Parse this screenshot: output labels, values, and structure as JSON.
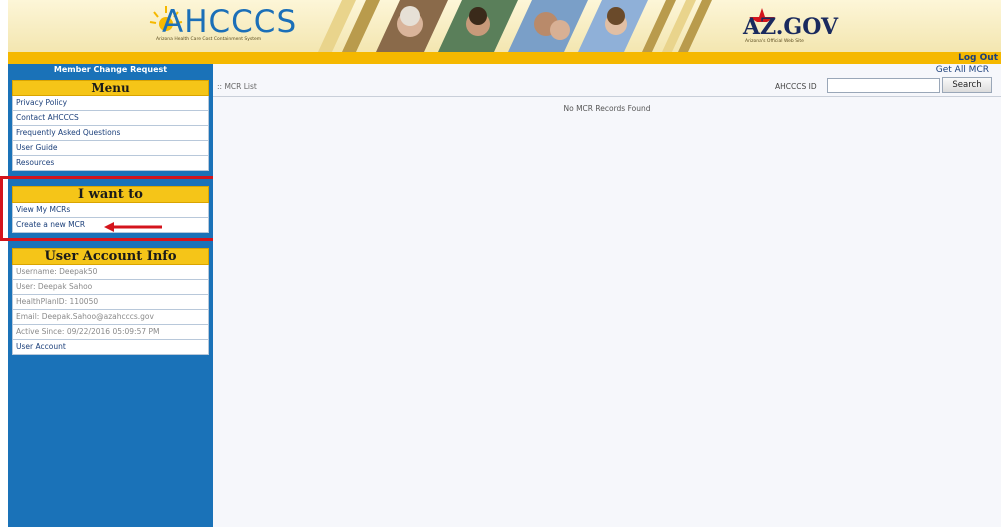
{
  "header": {
    "logo_text": "AHCCCS",
    "logo_subtitle": "Arizona Health Care Cost Containment System",
    "azgov_text": "AZ.GOV",
    "azgov_subtitle": "Arizona's Official Web Site",
    "logout_label": "Log Out"
  },
  "sidebar": {
    "title": "Member Change Request",
    "menu": {
      "heading": "Menu",
      "items": [
        {
          "label": "Privacy Policy"
        },
        {
          "label": "Contact AHCCCS"
        },
        {
          "label": "Frequently Asked Questions"
        },
        {
          "label": "User Guide"
        },
        {
          "label": "Resources"
        }
      ]
    },
    "i_want_to": {
      "heading": "I want to",
      "items": [
        {
          "label": "View My MCRs"
        },
        {
          "label": "Create a new MCR"
        }
      ]
    },
    "user_account_info": {
      "heading": "User Account Info",
      "username": "Username: Deepak50",
      "user": "User: Deepak Sahoo",
      "healthplan": "HealthPlanID: 110050",
      "email": "Email: Deepak.Sahoo@azahcccs.gov",
      "active_since": "Active Since: 09/22/2016 05:09:57 PM",
      "account_link": "User Account"
    }
  },
  "main": {
    "get_all_label": "Get All MCR",
    "breadcrumb": ":: MCR List",
    "search_label": "AHCCCS ID",
    "search_value": "",
    "search_button": "Search",
    "empty_message": "No MCR Records Found"
  },
  "colors": {
    "sidebar_bg": "#1a72b8",
    "gold_bar": "#f5b800",
    "panel_heading": "#f5c518",
    "highlight": "#d4141c",
    "link": "#1b3f7a"
  }
}
